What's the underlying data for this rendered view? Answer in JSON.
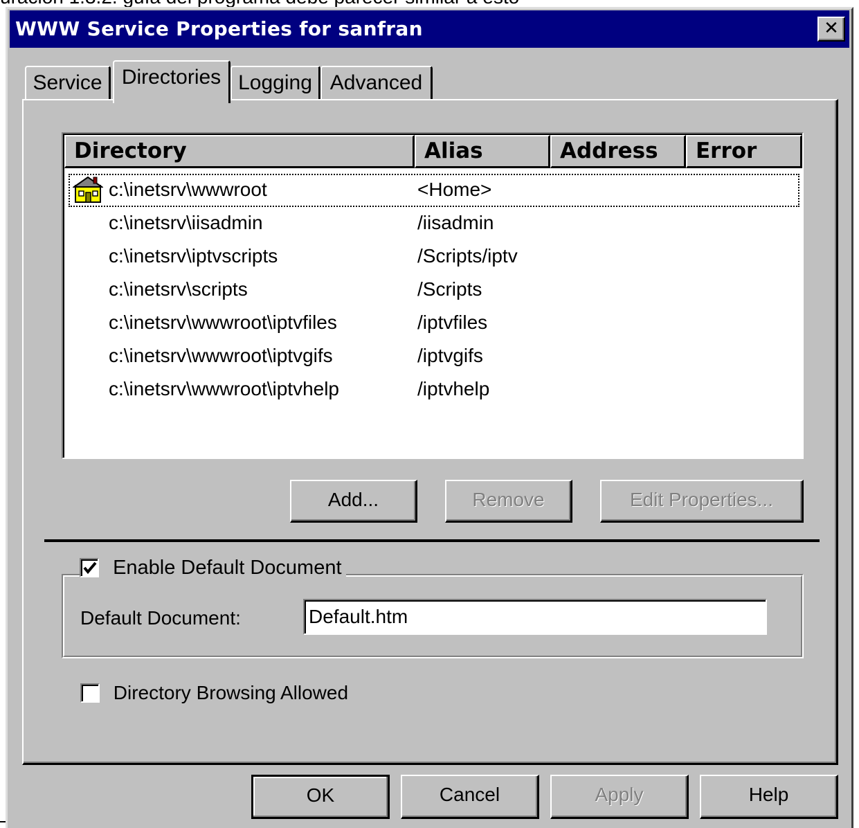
{
  "caption_text": "uración 1.3.2. guía del programa debe parecer similar a esto",
  "window": {
    "title": "WWW Service Properties for sanfran",
    "close_glyph": "✕"
  },
  "tabs": [
    {
      "label": "Service",
      "active": false
    },
    {
      "label": "Directories",
      "active": true
    },
    {
      "label": "Logging",
      "active": false
    },
    {
      "label": "Advanced",
      "active": false
    }
  ],
  "list": {
    "columns": [
      "Directory",
      "Alias",
      "Address",
      "Error"
    ],
    "rows": [
      {
        "directory": "c:\\inetsrv\\wwwroot",
        "alias": "<Home>",
        "icon": "home-folder-icon"
      },
      {
        "directory": "c:\\inetsrv\\iisadmin",
        "alias": "/iisadmin"
      },
      {
        "directory": "c:\\inetsrv\\iptvscripts",
        "alias": "/Scripts/iptv"
      },
      {
        "directory": "c:\\inetsrv\\scripts",
        "alias": "/Scripts"
      },
      {
        "directory": "c:\\inetsrv\\wwwroot\\iptvfiles",
        "alias": "/iptvfiles"
      },
      {
        "directory": "c:\\inetsrv\\wwwroot\\iptvgifs",
        "alias": "/iptvgifs"
      },
      {
        "directory": "c:\\inetsrv\\wwwroot\\iptvhelp",
        "alias": "/iptvhelp"
      }
    ]
  },
  "list_buttons": {
    "add": "Add...",
    "remove": "Remove",
    "edit": "Edit Properties..."
  },
  "default_doc": {
    "enable_label": "Enable Default Document",
    "enabled": true,
    "field_label": "Default Document:",
    "field_value": "Default.htm"
  },
  "browsing": {
    "label": "Directory Browsing Allowed",
    "checked": false
  },
  "footer_buttons": {
    "ok": "OK",
    "cancel": "Cancel",
    "apply": "Apply",
    "help": "Help"
  },
  "colors": {
    "titlebar": "#000080",
    "face": "#c0c0c0"
  }
}
